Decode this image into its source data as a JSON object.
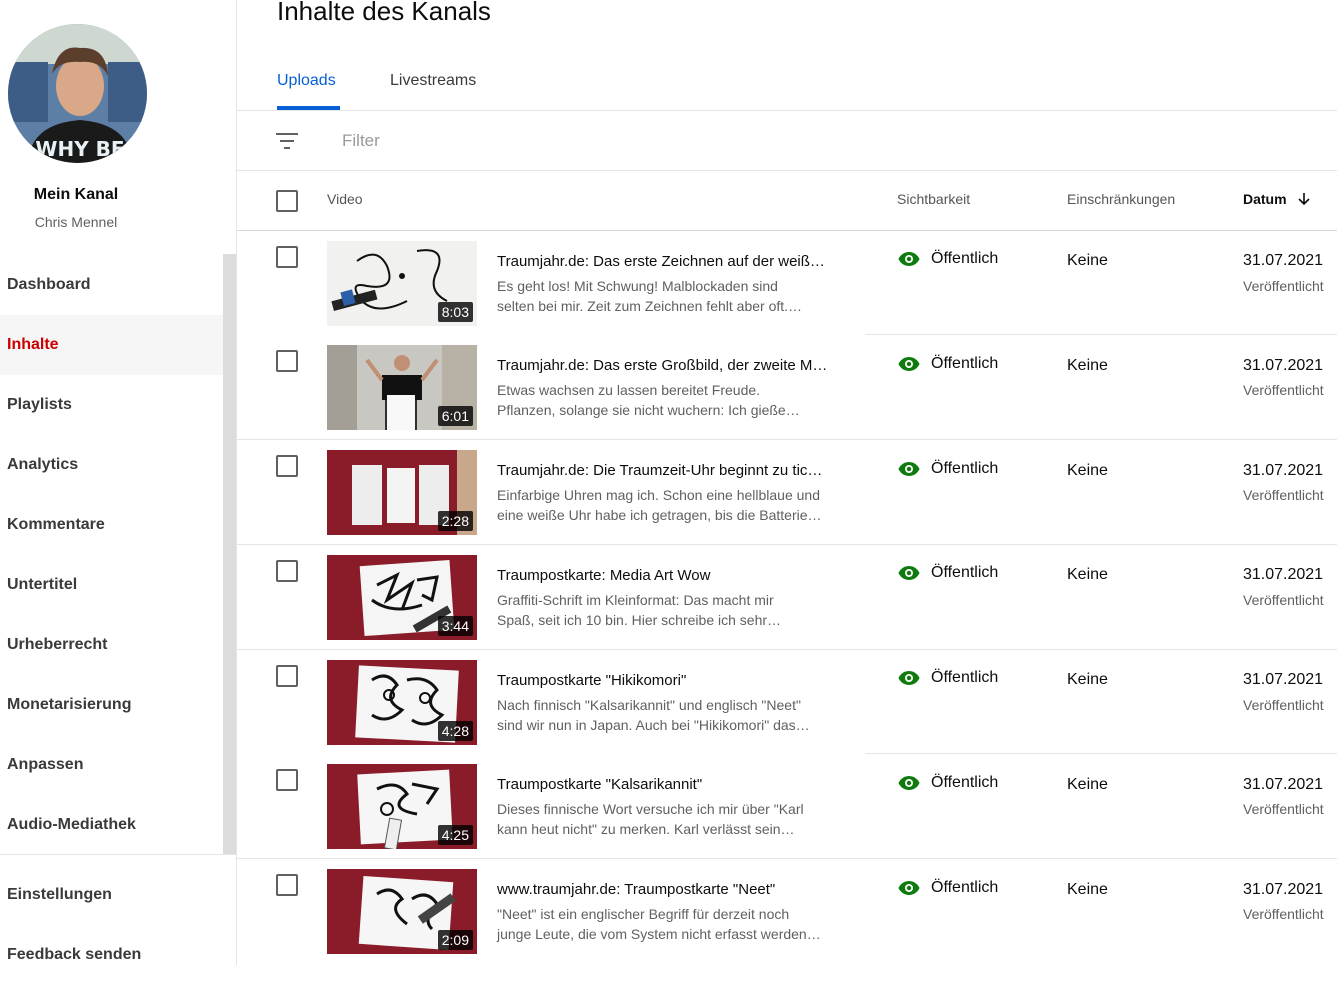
{
  "sidebar": {
    "channel_title": "Mein Kanal",
    "channel_name": "Chris Mennel",
    "avatar_shirt_text": "WHY BE",
    "items": [
      {
        "label": "Dashboard"
      },
      {
        "label": "Inhalte",
        "active": true
      },
      {
        "label": "Playlists"
      },
      {
        "label": "Analytics"
      },
      {
        "label": "Kommentare"
      },
      {
        "label": "Untertitel"
      },
      {
        "label": "Urheberrecht"
      },
      {
        "label": "Monetarisierung"
      },
      {
        "label": "Anpassen"
      },
      {
        "label": "Audio-Mediathek"
      }
    ],
    "bottom_items": [
      {
        "label": "Einstellungen"
      },
      {
        "label": "Feedback senden"
      }
    ]
  },
  "header": {
    "title": "Inhalte des Kanals"
  },
  "tabs": [
    {
      "label": "Uploads",
      "active": true
    },
    {
      "label": "Livestreams"
    }
  ],
  "filter": {
    "placeholder": "Filter"
  },
  "table": {
    "columns": {
      "video": "Video",
      "visibility": "Sichtbarkeit",
      "restrictions": "Einschränkungen",
      "date": "Datum"
    },
    "rows": [
      {
        "title": "Traumjahr.de: Das erste Zeichnen auf der weiß…",
        "desc1": "Es geht los! Mit Schwung! Malblockaden sind",
        "desc2": "selten bei mir. Zeit zum Zeichnen fehlt aber oft.…",
        "duration": "8:03",
        "visibility": "Öffentlich",
        "restrictions": "Keine",
        "date": "31.07.2021",
        "status": "Veröffentlicht"
      },
      {
        "title": "Traumjahr.de: Das erste Großbild, der zweite M…",
        "desc1": "Etwas wachsen zu lassen bereitet Freude.",
        "desc2": "Pflanzen, solange sie nicht wuchern: Ich gieße…",
        "duration": "6:01",
        "visibility": "Öffentlich",
        "restrictions": "Keine",
        "date": "31.07.2021",
        "status": "Veröffentlicht"
      },
      {
        "title": "Traumjahr.de: Die Traumzeit-Uhr beginnt zu tic…",
        "desc1": "Einfarbige Uhren mag ich. Schon eine hellblaue und",
        "desc2": "eine weiße Uhr habe ich getragen, bis die Batterie…",
        "duration": "2:28",
        "visibility": "Öffentlich",
        "restrictions": "Keine",
        "date": "31.07.2021",
        "status": "Veröffentlicht"
      },
      {
        "title": "Traumpostkarte: Media Art Wow",
        "desc1": "Graffiti-Schrift im Kleinformat: Das macht mir",
        "desc2": "Spaß, seit ich 10 bin. Hier schreibe ich sehr…",
        "duration": "3:44",
        "visibility": "Öffentlich",
        "restrictions": "Keine",
        "date": "31.07.2021",
        "status": "Veröffentlicht"
      },
      {
        "title": "Traumpostkarte \"Hikikomori\"",
        "desc1": "Nach finnisch \"Kalsarikannit\" und englisch \"Neet\"",
        "desc2": "sind wir nun in Japan. Auch bei \"Hikikomori\" das…",
        "duration": "4:28",
        "visibility": "Öffentlich",
        "restrictions": "Keine",
        "date": "31.07.2021",
        "status": "Veröffentlicht"
      },
      {
        "title": "Traumpostkarte \"Kalsarikannit\"",
        "desc1": "Dieses finnische Wort versuche ich mir über \"Karl",
        "desc2": "kann heut nicht\" zu merken. Karl verlässt sein…",
        "duration": "4:25",
        "visibility": "Öffentlich",
        "restrictions": "Keine",
        "date": "31.07.2021",
        "status": "Veröffentlicht"
      },
      {
        "title": "www.traumjahr.de: Traumpostkarte \"Neet\"",
        "desc1": "\"Neet\" ist ein englischer Begriff für derzeit noch",
        "desc2": "junge Leute, die vom System nicht erfasst werden…",
        "duration": "2:09",
        "visibility": "Öffentlich",
        "restrictions": "Keine",
        "date": "31.07.2021",
        "status": "Veröffentlicht"
      }
    ]
  },
  "colors": {
    "accent_blue": "#065fd4",
    "active_red": "#cc0000",
    "public_green": "#0f7b0f"
  }
}
